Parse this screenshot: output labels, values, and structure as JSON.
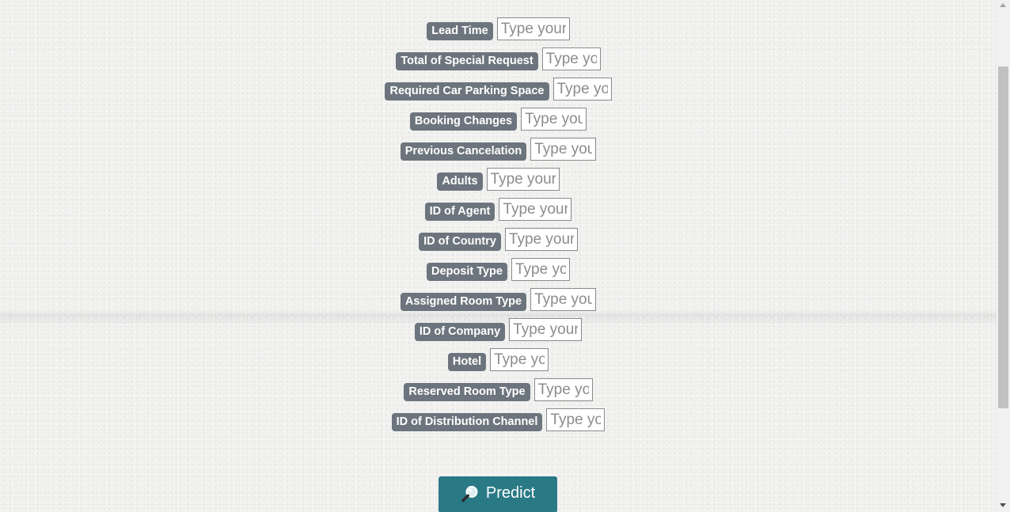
{
  "form": {
    "fields": [
      {
        "label": "Lead Time",
        "placeholder": "Type your answer here..."
      },
      {
        "label": "Total of Special Request",
        "placeholder": "Type your answer here..."
      },
      {
        "label": "Required Car Parking Space",
        "placeholder": "Type your answer here..."
      },
      {
        "label": "Booking Changes",
        "placeholder": "Type your answer here..."
      },
      {
        "label": "Previous Cancelation",
        "placeholder": "Type your answer here..."
      },
      {
        "label": "Adults",
        "placeholder": "Type your answer here..."
      },
      {
        "label": "ID of Agent",
        "placeholder": "Type your answer here..."
      },
      {
        "label": "ID of Country",
        "placeholder": "Type your answer here..."
      },
      {
        "label": "Deposit Type",
        "placeholder": "Type your answer here..."
      },
      {
        "label": "Assigned Room Type",
        "placeholder": "Type your answer here..."
      },
      {
        "label": "ID of Company",
        "placeholder": "Type your answer here..."
      },
      {
        "label": "Hotel",
        "placeholder": "Type your answer here..."
      },
      {
        "label": "Reserved Room Type",
        "placeholder": "Type your answer here..."
      },
      {
        "label": "ID of Distribution Channel",
        "placeholder": "Type your answer here..."
      }
    ]
  },
  "predict_button": {
    "label": "Predict",
    "icon": "magnifier-icon",
    "color": "#2a7a85"
  },
  "colors": {
    "badge": "#6c757d",
    "background": "#f2f2f1"
  }
}
